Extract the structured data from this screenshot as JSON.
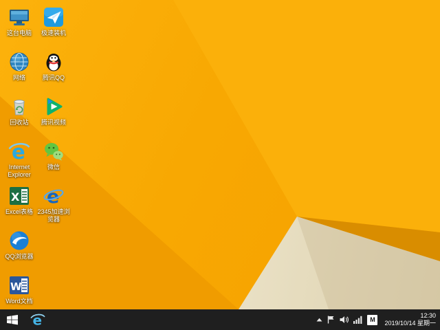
{
  "desktop": {
    "col1": [
      {
        "label": "这台电脑",
        "icon": "monitor-icon"
      },
      {
        "label": "网络",
        "icon": "globe-icon"
      },
      {
        "label": "回收站",
        "icon": "recycle-bin-icon"
      },
      {
        "label": "Internet Explorer",
        "icon": "ie-e-icon"
      },
      {
        "label": "Excel表格",
        "icon": "excel-icon"
      },
      {
        "label": "QQ浏览器",
        "icon": "qq-browser-icon"
      },
      {
        "label": "Word文档",
        "icon": "word-icon"
      }
    ],
    "col2": [
      {
        "label": "极速装机",
        "icon": "paper-plane-icon"
      },
      {
        "label": "腾讯QQ",
        "icon": "qq-penguin-icon"
      },
      {
        "label": "腾讯视频",
        "icon": "play-triangle-icon"
      },
      {
        "label": "微信",
        "icon": "wechat-bubbles-icon"
      },
      {
        "label": "2345加速浏览器",
        "icon": "browser-e-icon"
      }
    ]
  },
  "taskbar": {
    "start": "start-windows-logo",
    "pinned": [
      "internet-explorer"
    ],
    "tray_icons": [
      "hidden-icons-arrow",
      "action-center-flag-icon",
      "volume-icon",
      "network-bars-icon"
    ],
    "ime": "M",
    "time": "12:30",
    "date": "2019/10/14 星期一"
  },
  "colors": {
    "wallpaper_orange": "#f8a802",
    "wallpaper_orange_dark": "#d98d00",
    "wallpaper_cream": "#e9e0c4",
    "taskbar_bg": "#1f1f1f",
    "label_text": "#ffffff"
  }
}
